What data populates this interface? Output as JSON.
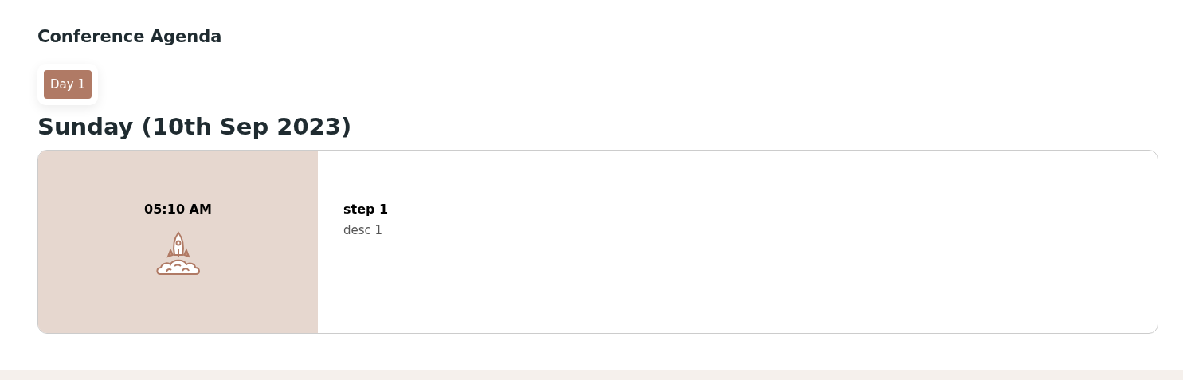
{
  "title": "Conference Agenda",
  "tabs": [
    {
      "label": "Day 1",
      "selected": true
    }
  ],
  "day_heading": "Sunday (10th Sep 2023)",
  "sessions": [
    {
      "time": "05:10 AM",
      "title": "step 1",
      "description": "desc 1"
    }
  ]
}
